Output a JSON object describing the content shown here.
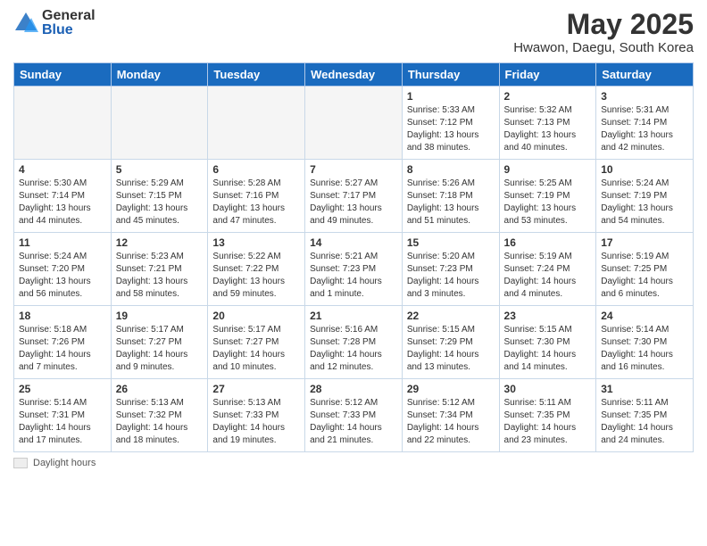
{
  "logo": {
    "general": "General",
    "blue": "Blue"
  },
  "title": "May 2025",
  "location": "Hwawon, Daegu, South Korea",
  "weekdays": [
    "Sunday",
    "Monday",
    "Tuesday",
    "Wednesday",
    "Thursday",
    "Friday",
    "Saturday"
  ],
  "weeks": [
    [
      {
        "day": "",
        "info": ""
      },
      {
        "day": "",
        "info": ""
      },
      {
        "day": "",
        "info": ""
      },
      {
        "day": "",
        "info": ""
      },
      {
        "day": "1",
        "info": "Sunrise: 5:33 AM\nSunset: 7:12 PM\nDaylight: 13 hours\nand 38 minutes."
      },
      {
        "day": "2",
        "info": "Sunrise: 5:32 AM\nSunset: 7:13 PM\nDaylight: 13 hours\nand 40 minutes."
      },
      {
        "day": "3",
        "info": "Sunrise: 5:31 AM\nSunset: 7:14 PM\nDaylight: 13 hours\nand 42 minutes."
      }
    ],
    [
      {
        "day": "4",
        "info": "Sunrise: 5:30 AM\nSunset: 7:14 PM\nDaylight: 13 hours\nand 44 minutes."
      },
      {
        "day": "5",
        "info": "Sunrise: 5:29 AM\nSunset: 7:15 PM\nDaylight: 13 hours\nand 45 minutes."
      },
      {
        "day": "6",
        "info": "Sunrise: 5:28 AM\nSunset: 7:16 PM\nDaylight: 13 hours\nand 47 minutes."
      },
      {
        "day": "7",
        "info": "Sunrise: 5:27 AM\nSunset: 7:17 PM\nDaylight: 13 hours\nand 49 minutes."
      },
      {
        "day": "8",
        "info": "Sunrise: 5:26 AM\nSunset: 7:18 PM\nDaylight: 13 hours\nand 51 minutes."
      },
      {
        "day": "9",
        "info": "Sunrise: 5:25 AM\nSunset: 7:19 PM\nDaylight: 13 hours\nand 53 minutes."
      },
      {
        "day": "10",
        "info": "Sunrise: 5:24 AM\nSunset: 7:19 PM\nDaylight: 13 hours\nand 54 minutes."
      }
    ],
    [
      {
        "day": "11",
        "info": "Sunrise: 5:24 AM\nSunset: 7:20 PM\nDaylight: 13 hours\nand 56 minutes."
      },
      {
        "day": "12",
        "info": "Sunrise: 5:23 AM\nSunset: 7:21 PM\nDaylight: 13 hours\nand 58 minutes."
      },
      {
        "day": "13",
        "info": "Sunrise: 5:22 AM\nSunset: 7:22 PM\nDaylight: 13 hours\nand 59 minutes."
      },
      {
        "day": "14",
        "info": "Sunrise: 5:21 AM\nSunset: 7:23 PM\nDaylight: 14 hours\nand 1 minute."
      },
      {
        "day": "15",
        "info": "Sunrise: 5:20 AM\nSunset: 7:23 PM\nDaylight: 14 hours\nand 3 minutes."
      },
      {
        "day": "16",
        "info": "Sunrise: 5:19 AM\nSunset: 7:24 PM\nDaylight: 14 hours\nand 4 minutes."
      },
      {
        "day": "17",
        "info": "Sunrise: 5:19 AM\nSunset: 7:25 PM\nDaylight: 14 hours\nand 6 minutes."
      }
    ],
    [
      {
        "day": "18",
        "info": "Sunrise: 5:18 AM\nSunset: 7:26 PM\nDaylight: 14 hours\nand 7 minutes."
      },
      {
        "day": "19",
        "info": "Sunrise: 5:17 AM\nSunset: 7:27 PM\nDaylight: 14 hours\nand 9 minutes."
      },
      {
        "day": "20",
        "info": "Sunrise: 5:17 AM\nSunset: 7:27 PM\nDaylight: 14 hours\nand 10 minutes."
      },
      {
        "day": "21",
        "info": "Sunrise: 5:16 AM\nSunset: 7:28 PM\nDaylight: 14 hours\nand 12 minutes."
      },
      {
        "day": "22",
        "info": "Sunrise: 5:15 AM\nSunset: 7:29 PM\nDaylight: 14 hours\nand 13 minutes."
      },
      {
        "day": "23",
        "info": "Sunrise: 5:15 AM\nSunset: 7:30 PM\nDaylight: 14 hours\nand 14 minutes."
      },
      {
        "day": "24",
        "info": "Sunrise: 5:14 AM\nSunset: 7:30 PM\nDaylight: 14 hours\nand 16 minutes."
      }
    ],
    [
      {
        "day": "25",
        "info": "Sunrise: 5:14 AM\nSunset: 7:31 PM\nDaylight: 14 hours\nand 17 minutes."
      },
      {
        "day": "26",
        "info": "Sunrise: 5:13 AM\nSunset: 7:32 PM\nDaylight: 14 hours\nand 18 minutes."
      },
      {
        "day": "27",
        "info": "Sunrise: 5:13 AM\nSunset: 7:33 PM\nDaylight: 14 hours\nand 19 minutes."
      },
      {
        "day": "28",
        "info": "Sunrise: 5:12 AM\nSunset: 7:33 PM\nDaylight: 14 hours\nand 21 minutes."
      },
      {
        "day": "29",
        "info": "Sunrise: 5:12 AM\nSunset: 7:34 PM\nDaylight: 14 hours\nand 22 minutes."
      },
      {
        "day": "30",
        "info": "Sunrise: 5:11 AM\nSunset: 7:35 PM\nDaylight: 14 hours\nand 23 minutes."
      },
      {
        "day": "31",
        "info": "Sunrise: 5:11 AM\nSunset: 7:35 PM\nDaylight: 14 hours\nand 24 minutes."
      }
    ]
  ],
  "footer": {
    "box_label": "Daylight hours"
  }
}
